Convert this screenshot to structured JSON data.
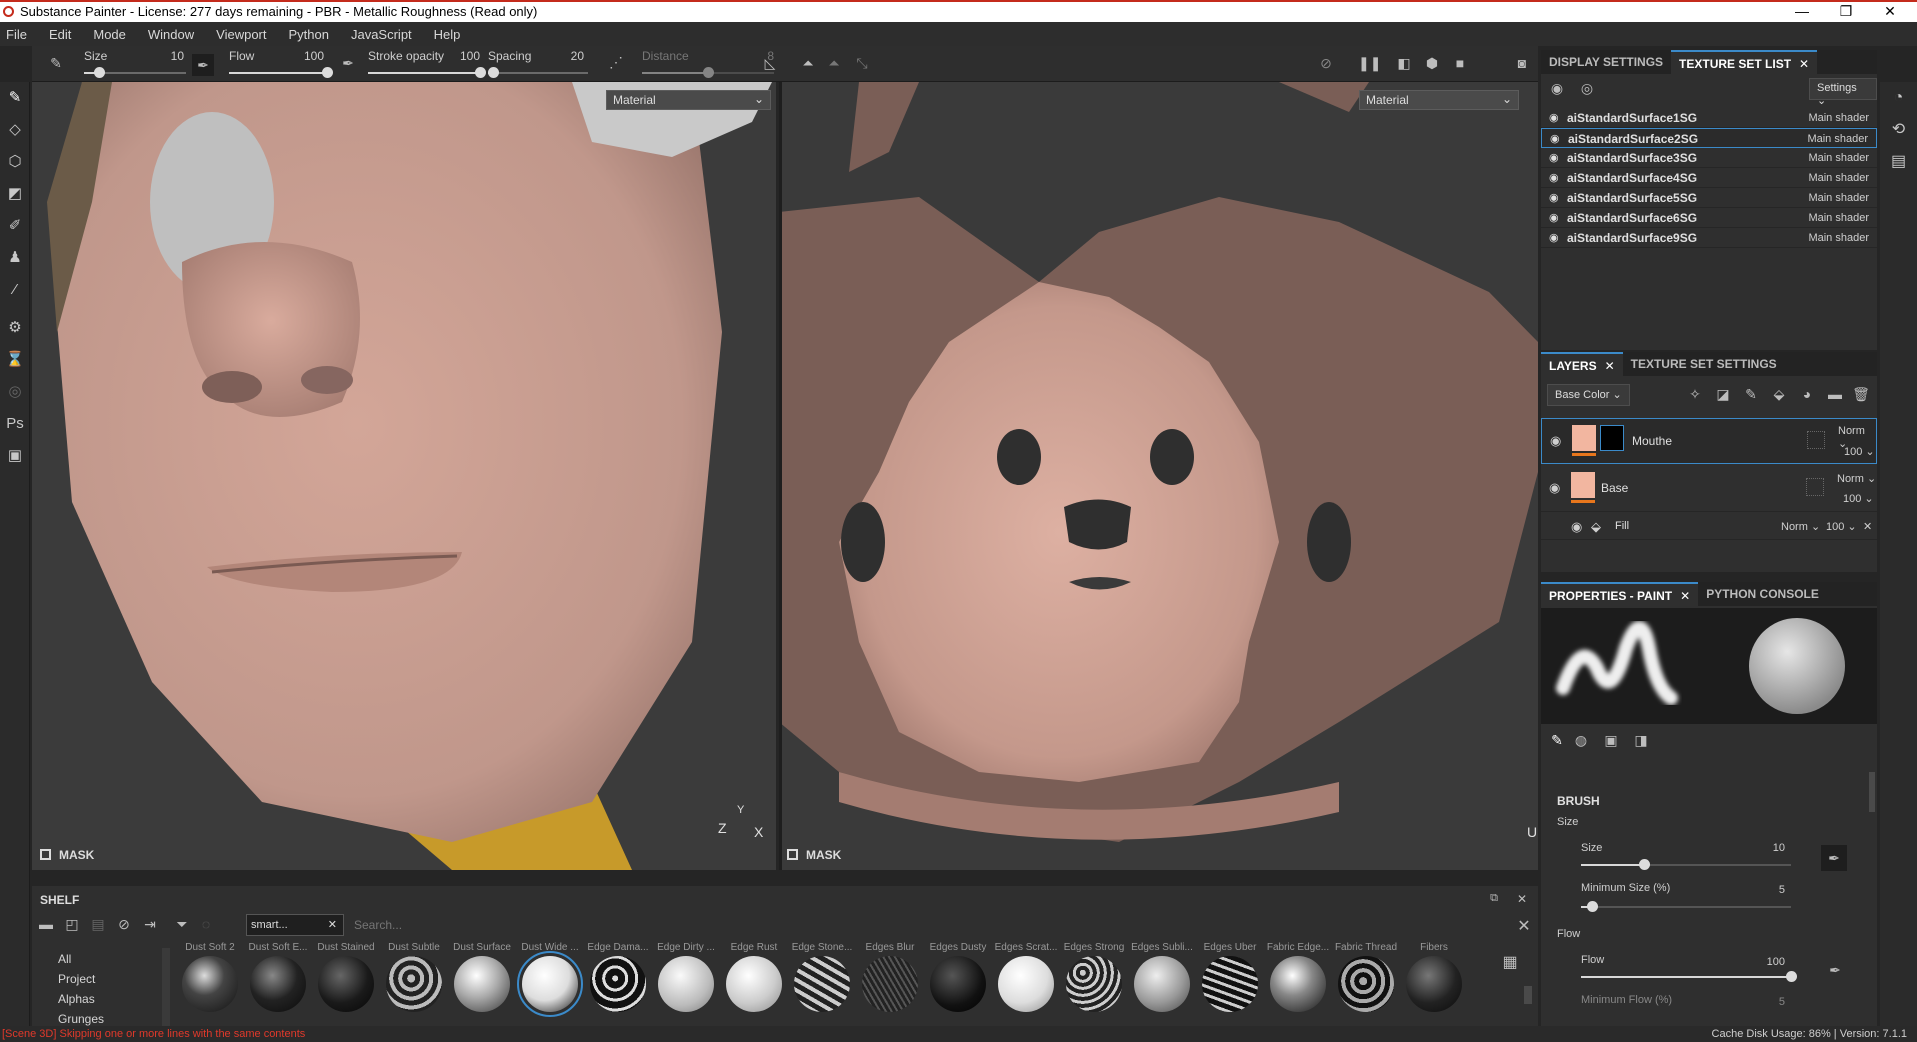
{
  "window": {
    "title": "Substance Painter - License: 277 days remaining - PBR - Metallic Roughness (Read only)",
    "minimize": "—",
    "maximize": "❐",
    "close": "✕"
  },
  "menu": [
    "File",
    "Edit",
    "Mode",
    "Window",
    "Viewport",
    "Python",
    "JavaScript",
    "Help"
  ],
  "tool_options": {
    "size": {
      "label": "Size",
      "value": "10",
      "fraction": 0.15
    },
    "flow": {
      "label": "Flow",
      "value": "100",
      "fraction": 1.0
    },
    "stroke_opacity": {
      "label": "Stroke opacity",
      "value": "100",
      "fraction": 1.0
    },
    "spacing": {
      "label": "Spacing",
      "value": "20",
      "fraction": 0.05
    },
    "distance": {
      "label": "Distance",
      "value": "8",
      "fraction": 0.5
    }
  },
  "viewport_3d": {
    "mode": "Material",
    "mask_label": "MASK",
    "axis_z": "Z",
    "axis_y": "Y",
    "axis_x": "X"
  },
  "viewport_2d": {
    "mode": "Material",
    "mask_label": "MASK",
    "axis_u": "U"
  },
  "texture_set_panel": {
    "tabs": [
      "DISPLAY SETTINGS",
      "TEXTURE SET LIST"
    ],
    "settings_label": "Settings",
    "items": [
      {
        "name": "aiStandardSurface1SG",
        "shader": "Main shader"
      },
      {
        "name": "aiStandardSurface2SG",
        "shader": "Main shader"
      },
      {
        "name": "aiStandardSurface3SG",
        "shader": "Main shader"
      },
      {
        "name": "aiStandardSurface4SG",
        "shader": "Main shader"
      },
      {
        "name": "aiStandardSurface5SG",
        "shader": "Main shader"
      },
      {
        "name": "aiStandardSurface6SG",
        "shader": "Main shader"
      },
      {
        "name": "aiStandardSurface9SG",
        "shader": "Main shader"
      }
    ],
    "selected_index": 1
  },
  "layers_panel": {
    "tabs": [
      "LAYERS",
      "TEXTURE SET SETTINGS"
    ],
    "channel": "Base Color",
    "layers": [
      {
        "name": "Mouthe",
        "blend": "Norm",
        "opacity": "100"
      },
      {
        "name": "Base",
        "blend": "Norm",
        "opacity": "100"
      }
    ],
    "effect": {
      "name": "Fill",
      "blend": "Norm",
      "opacity": "100"
    }
  },
  "properties_panel": {
    "tabs": [
      "PROPERTIES - PAINT",
      "PYTHON CONSOLE"
    ],
    "brush_section": "BRUSH",
    "size_group": "Size",
    "size": {
      "label": "Size",
      "value": "10",
      "fraction": 0.3
    },
    "min_size": {
      "label": "Minimum Size (%)",
      "value": "5",
      "fraction": 0.05
    },
    "flow_group": "Flow",
    "flow": {
      "label": "Flow",
      "value": "100",
      "fraction": 1.0
    },
    "min_flow": {
      "label": "Minimum Flow (%)",
      "value": "5"
    }
  },
  "shelf": {
    "title": "SHELF",
    "filter_tag": "smart...",
    "search_placeholder": "Search...",
    "categories": [
      "All",
      "Project",
      "Alphas",
      "Grunges"
    ],
    "materials": [
      "Dust Soft 2",
      "Dust Soft E...",
      "Dust Stained",
      "Dust Subtle",
      "Dust Surface",
      "Dust Wide ...",
      "Edge Dama...",
      "Edge Dirty ...",
      "Edge Rust",
      "Edge Stone...",
      "Edges Blur",
      "Edges Dusty",
      "Edges Scrat...",
      "Edges Strong",
      "Edges Subli...",
      "Edges Uber",
      "Fabric Edge...",
      "Fabric Thread",
      "Fibers"
    ]
  },
  "status": {
    "message": "[Scene 3D] Skipping one or more lines with the same contents",
    "cache": "Cache Disk Usage:   86% | Version: 7.1.1"
  },
  "colors": {
    "accent": "#3b8ac9",
    "skin": "#c99c8e",
    "hair": "#7a5e56",
    "error": "#e0392b"
  }
}
